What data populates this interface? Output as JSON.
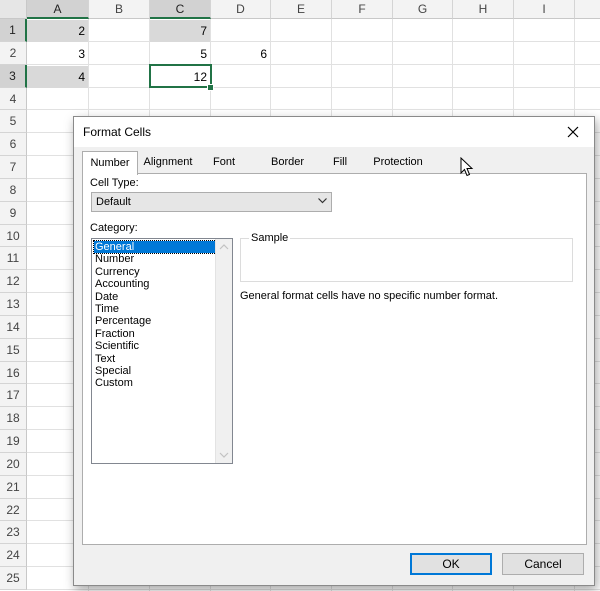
{
  "sheet": {
    "columns": [
      "A",
      "B",
      "C",
      "D",
      "E",
      "F",
      "G",
      "H",
      "I"
    ],
    "rows": [
      "1",
      "2",
      "3",
      "4",
      "5",
      "6",
      "7",
      "8",
      "9",
      "10",
      "11",
      "12",
      "13",
      "14",
      "15",
      "16",
      "17",
      "18",
      "19",
      "20",
      "21",
      "22",
      "23",
      "24",
      "25"
    ],
    "cells": {
      "a1": "2",
      "a2": "3",
      "a3": "4",
      "c1": "7",
      "c2": "5",
      "c3": "12",
      "d2": "6"
    },
    "accent_color": "#217346"
  },
  "dialog": {
    "title": "Format Cells",
    "tabs": [
      "Number",
      "Alignment",
      "Font",
      "Border",
      "Fill",
      "Protection"
    ],
    "active_tab": "Number",
    "cell_type_label": "Cell Type:",
    "cell_type_value": "Default",
    "category_label": "Category:",
    "categories": [
      "General",
      "Number",
      "Currency",
      "Accounting",
      "Date",
      "Time",
      "Percentage",
      "Fraction",
      "Scientific",
      "Text",
      "Special",
      "Custom"
    ],
    "selected_category": "General",
    "sample_label": "Sample",
    "description": "General format cells have no specific number format.",
    "ok_label": "OK",
    "cancel_label": "Cancel",
    "selection_color": "#0078d7"
  }
}
